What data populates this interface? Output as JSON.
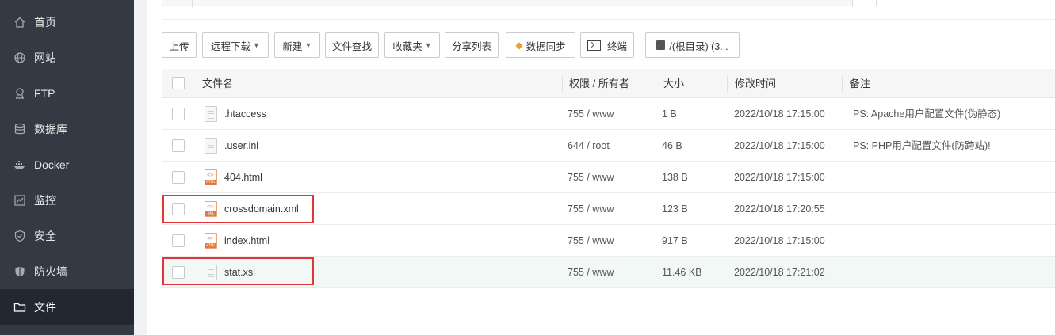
{
  "sidebar": {
    "items": [
      {
        "label": "首页",
        "icon": "home-icon"
      },
      {
        "label": "网站",
        "icon": "globe-icon"
      },
      {
        "label": "FTP",
        "icon": "ftp-icon"
      },
      {
        "label": "数据库",
        "icon": "database-icon"
      },
      {
        "label": "Docker",
        "icon": "docker-icon"
      },
      {
        "label": "监控",
        "icon": "monitor-icon"
      },
      {
        "label": "安全",
        "icon": "shield-icon"
      },
      {
        "label": "防火墙",
        "icon": "firewall-icon"
      },
      {
        "label": "文件",
        "icon": "folder-icon",
        "active": true
      }
    ]
  },
  "toolbar": {
    "upload": "上传",
    "remote_download": "远程下载",
    "new": "新建",
    "file_search": "文件查找",
    "favorites": "收藏夹",
    "share_list": "分享列表",
    "data_sync": "数据同步",
    "terminal": "终端",
    "root_dir": "/(根目录) (3..."
  },
  "table": {
    "headers": [
      "文件名",
      "权限 / 所有者",
      "大小",
      "修改时间",
      "备注"
    ],
    "rows": [
      {
        "name": ".htaccess",
        "icon": "doc",
        "perm": "755 / www",
        "size": "1 B",
        "mtime": "2022/10/18 17:15:00",
        "note": "PS: Apache用户配置文件(伪静态)"
      },
      {
        "name": ".user.ini",
        "icon": "doc",
        "perm": "644 / root",
        "size": "46 B",
        "mtime": "2022/10/18 17:15:00",
        "note": "PS: PHP用户配置文件(防跨站)!"
      },
      {
        "name": "404.html",
        "icon": "html",
        "perm": "755 / www",
        "size": "138 B",
        "mtime": "2022/10/18 17:15:00",
        "note": ""
      },
      {
        "name": "crossdomain.xml",
        "icon": "xml",
        "perm": "755 / www",
        "size": "123 B",
        "mtime": "2022/10/18 17:20:55",
        "note": ""
      },
      {
        "name": "index.html",
        "icon": "html",
        "perm": "755 / www",
        "size": "917 B",
        "mtime": "2022/10/18 17:15:00",
        "note": ""
      },
      {
        "name": "stat.xsl",
        "icon": "doc",
        "perm": "755 / www",
        "size": "11.46 KB",
        "mtime": "2022/10/18 17:21:02",
        "note": ""
      }
    ]
  },
  "colors": {
    "sidebar": "#333a44",
    "highlight": "#e33535",
    "accent": "#f0a030"
  }
}
